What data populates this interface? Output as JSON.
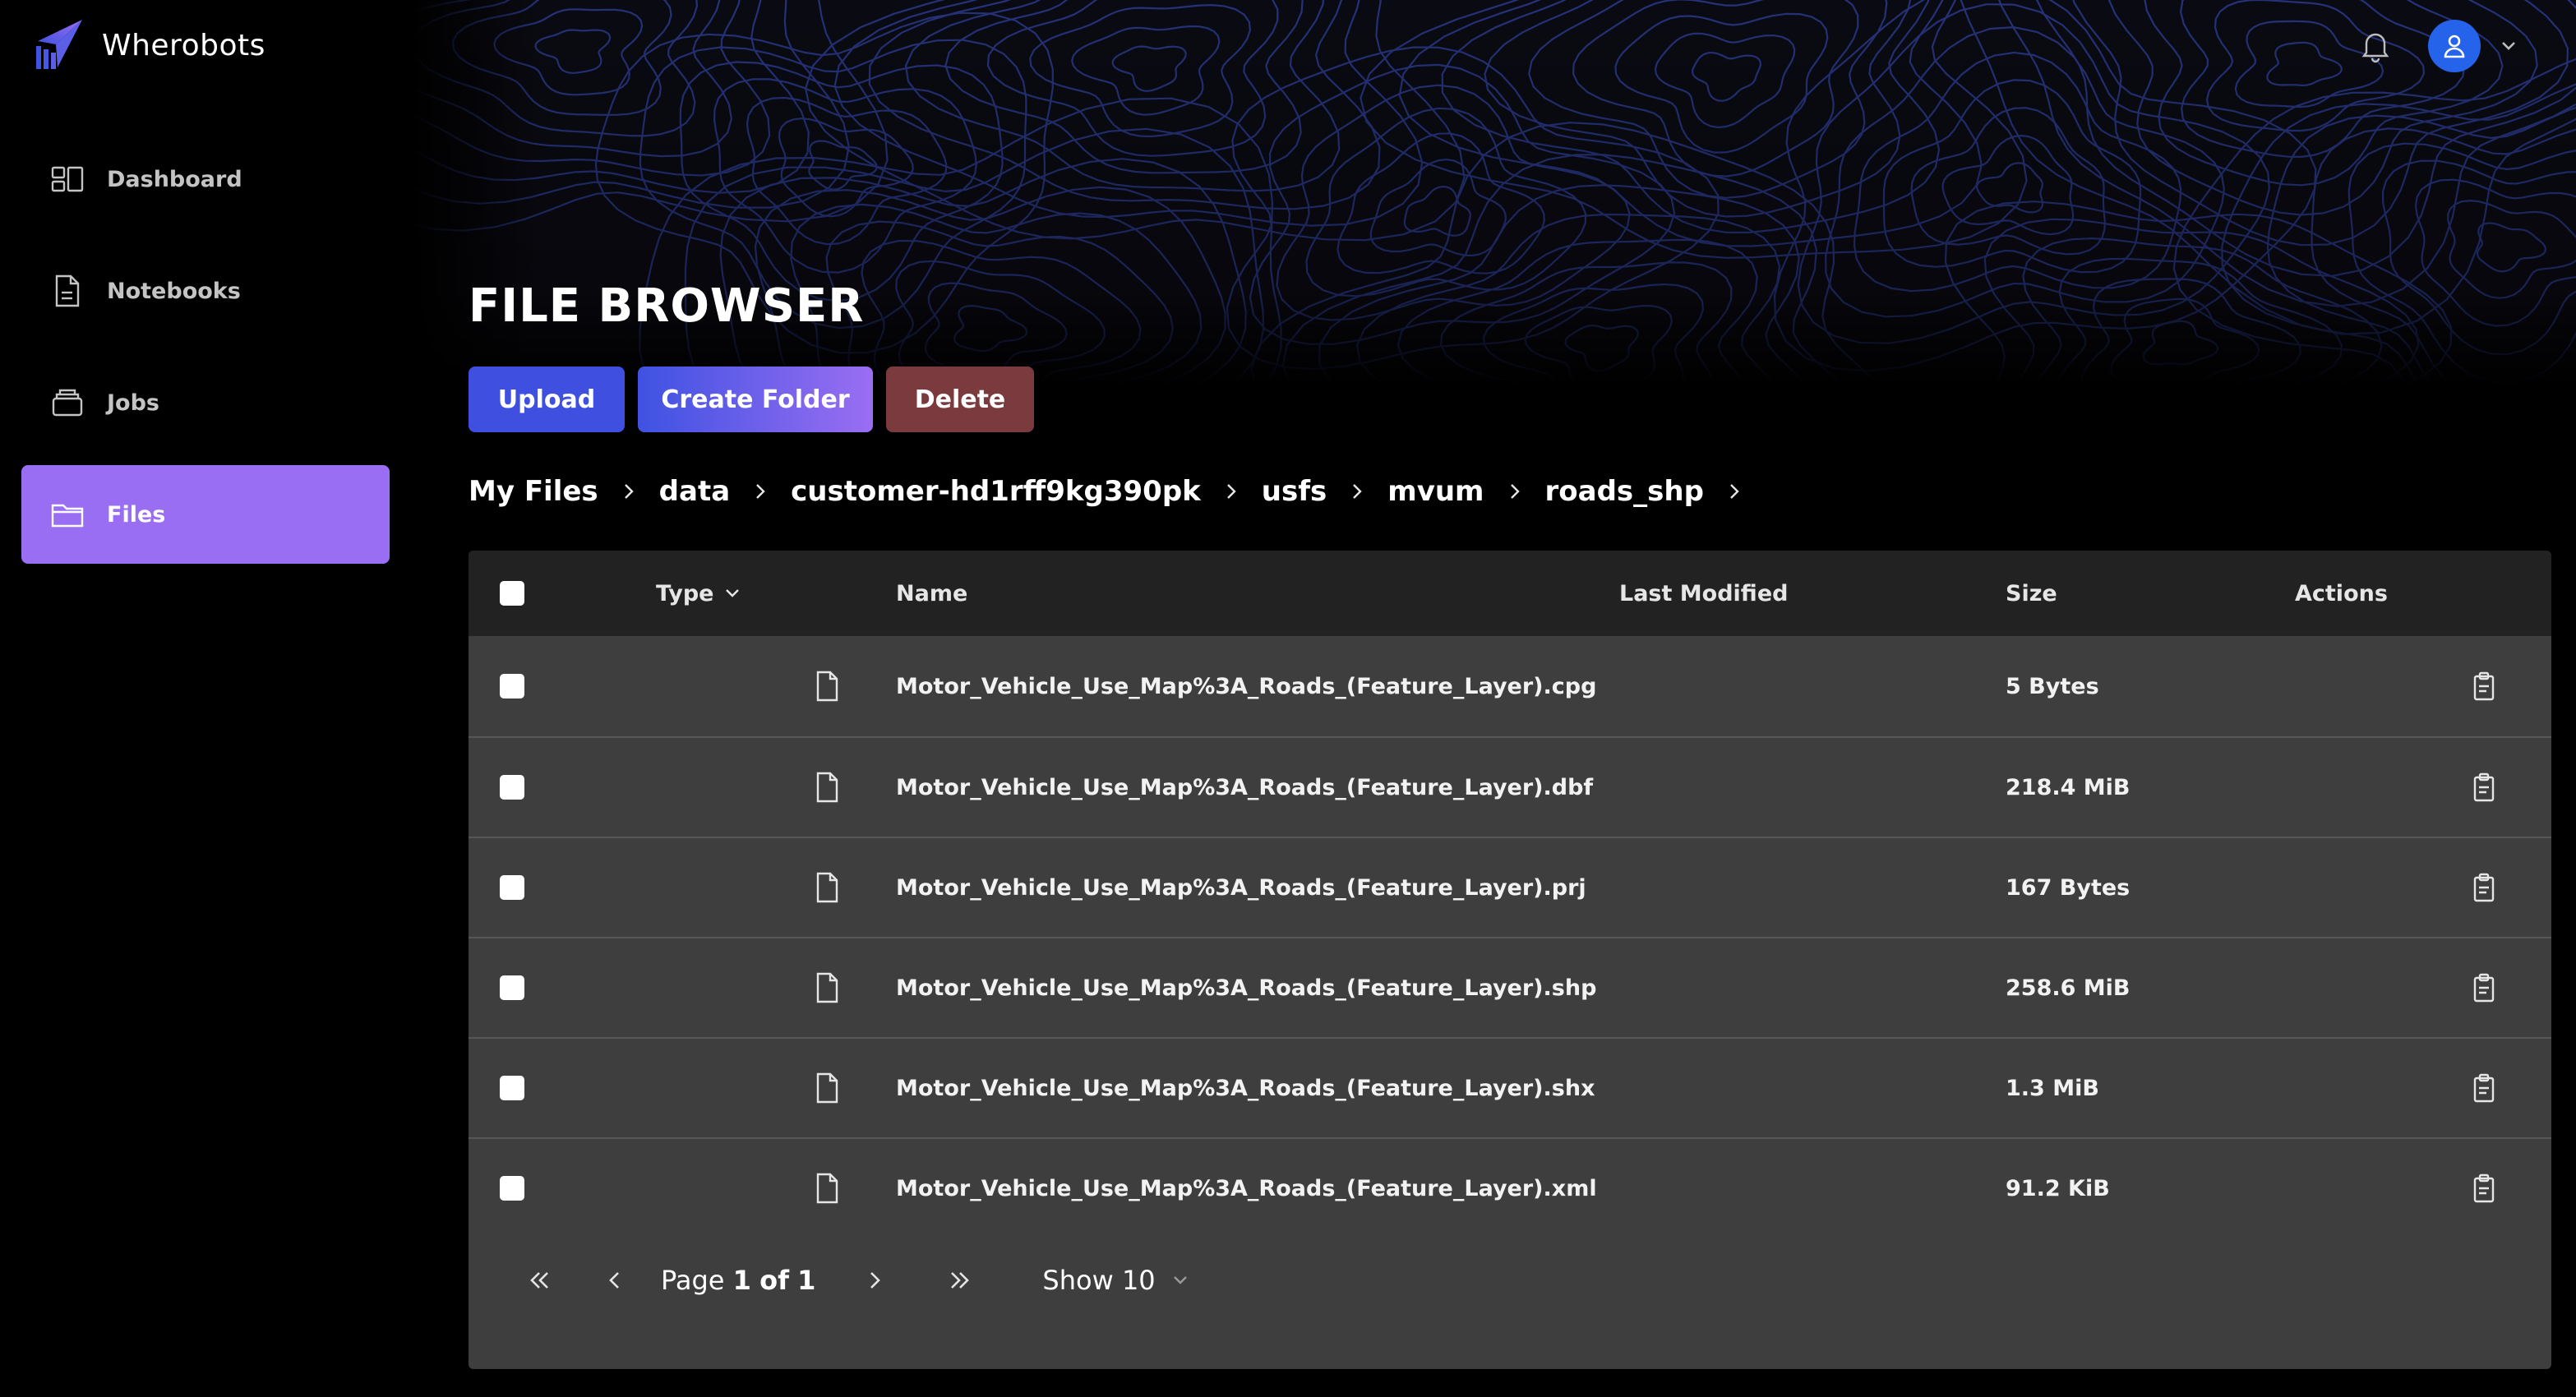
{
  "brand": {
    "name": "Wherobots"
  },
  "sidebar": {
    "items": [
      {
        "label": "Dashboard",
        "icon": "dashboard-icon",
        "active": false
      },
      {
        "label": "Notebooks",
        "icon": "notebook-icon",
        "active": false
      },
      {
        "label": "Jobs",
        "icon": "jobs-icon",
        "active": false
      },
      {
        "label": "Files",
        "icon": "folder-icon",
        "active": true
      }
    ]
  },
  "header": {
    "title": "FILE BROWSER",
    "icons": [
      "bell-icon",
      "user-avatar-icon",
      "chevron-down-icon"
    ]
  },
  "toolbar": {
    "upload_label": "Upload",
    "create_folder_label": "Create Folder",
    "delete_label": "Delete"
  },
  "breadcrumb": [
    "My Files",
    "data",
    "customer-hd1rff9kg390pk",
    "usfs",
    "mvum",
    "roads_shp"
  ],
  "table": {
    "columns": {
      "type": "Type",
      "name": "Name",
      "last_modified": "Last Modified",
      "size": "Size",
      "actions": "Actions"
    },
    "rows": [
      {
        "name": "Motor_Vehicle_Use_Map%3A_Roads_(Feature_Layer).cpg",
        "last_modified": "",
        "size": "5 Bytes"
      },
      {
        "name": "Motor_Vehicle_Use_Map%3A_Roads_(Feature_Layer).dbf",
        "last_modified": "",
        "size": "218.4 MiB"
      },
      {
        "name": "Motor_Vehicle_Use_Map%3A_Roads_(Feature_Layer).prj",
        "last_modified": "",
        "size": "167 Bytes"
      },
      {
        "name": "Motor_Vehicle_Use_Map%3A_Roads_(Feature_Layer).shp",
        "last_modified": "",
        "size": "258.6 MiB"
      },
      {
        "name": "Motor_Vehicle_Use_Map%3A_Roads_(Feature_Layer).shx",
        "last_modified": "",
        "size": "1.3 MiB"
      },
      {
        "name": "Motor_Vehicle_Use_Map%3A_Roads_(Feature_Layer).xml",
        "last_modified": "",
        "size": "91.2 KiB"
      }
    ]
  },
  "pagination": {
    "page_word": "Page",
    "current": "1",
    "of_word": "of",
    "total": "1",
    "show_label": "Show 10"
  },
  "colors": {
    "accent": "#9a6ef2",
    "primary": "#3f4fe0",
    "danger": "#7a3a3e",
    "avatar": "#2563eb",
    "table_bg": "#3e3e3e",
    "table_header_bg": "#222222"
  }
}
